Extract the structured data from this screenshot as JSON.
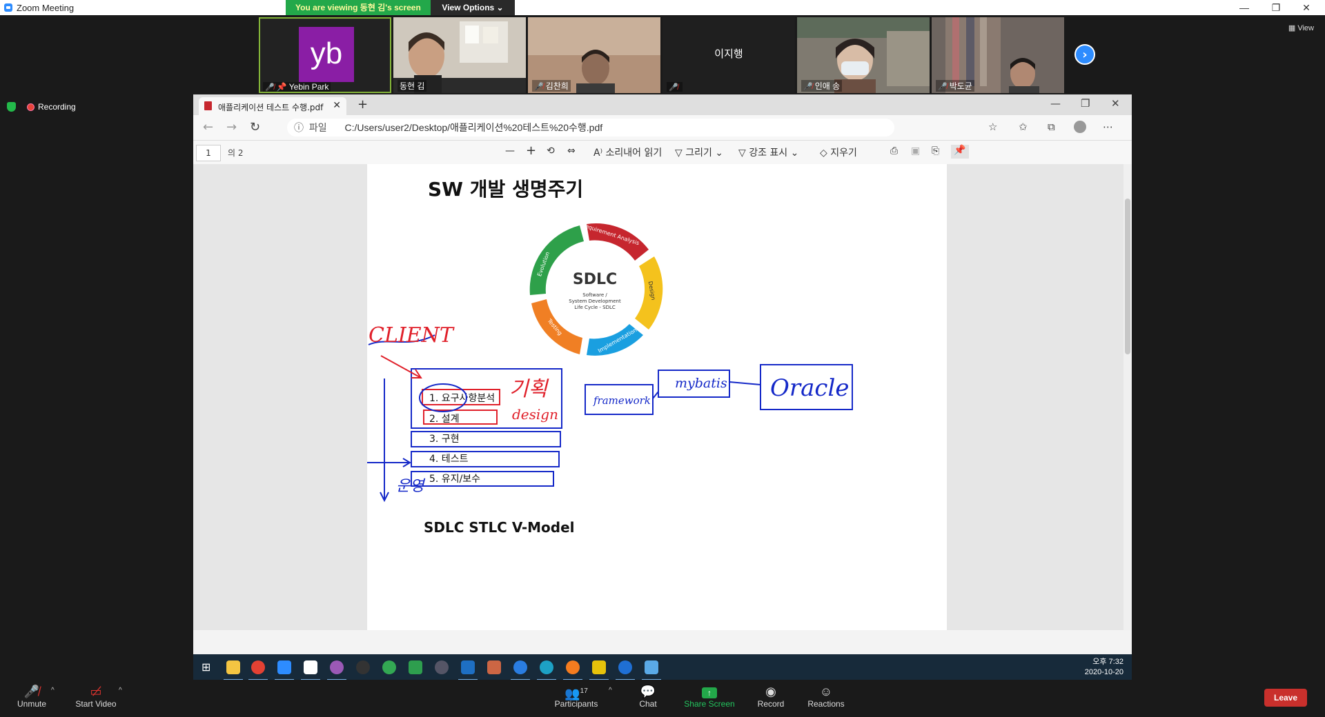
{
  "window": {
    "title": "Zoom Meeting"
  },
  "banner": {
    "message": "You are viewing 동현 김's screen",
    "view_options": "View Options ⌄"
  },
  "view_button": "View",
  "participants_strip": [
    {
      "name": "Yebin Park",
      "initials": "yb"
    },
    {
      "name": "동현 김"
    },
    {
      "name": "김찬희"
    },
    {
      "name": "",
      "center_name": "이지행"
    },
    {
      "name": "인애 송"
    },
    {
      "name": "박도균"
    }
  ],
  "recording": {
    "label": "Recording"
  },
  "browser": {
    "tab_title": "애플리케이션 테스트 수행.pdf",
    "scheme_label": "파일",
    "url": "C:/Users/user2/Desktop/애플리케이션%20테스트%20수행.pdf",
    "page_current": "1",
    "page_count": "의 2",
    "toolbar": {
      "read_aloud": "소리내어 읽기",
      "draw": "그리기",
      "highlight": "강조 표시",
      "erase": "지우기"
    }
  },
  "slide": {
    "title": "SW 개발 생명주기",
    "cycle_center": "SDLC",
    "cycle_subtitle_1": "Software /",
    "cycle_subtitle_2": "System Development",
    "cycle_subtitle_3": "Life Cycle - SDLC",
    "cycle_segments": [
      "Requirement Analysis",
      "Design",
      "Implementation",
      "Testing",
      "Evolution"
    ],
    "steps": [
      "1. 요구사항분석",
      "2. 설계",
      "3. 구현",
      "4. 테스트",
      "5. 유지/보수"
    ],
    "bottom_title": "SDLC STLC V-Model",
    "handwriting": {
      "client": "CLIENT",
      "plan": "기획",
      "design": "design",
      "framework": "framework",
      "mybatis": "mybatis",
      "oracle": "Oracle",
      "ops": "운영"
    }
  },
  "taskbar": {
    "time": "오후 7:32",
    "date": "2020-10-20"
  },
  "toolbar": {
    "unmute": "Unmute",
    "start_video": "Start Video",
    "participants": "Participants",
    "participant_count": "17",
    "chat": "Chat",
    "share_screen": "Share Screen",
    "record": "Record",
    "reactions": "Reactions",
    "leave": "Leave"
  },
  "colors": {
    "zoom_blue": "#2d8cff",
    "share_green": "#23a84a",
    "leave_red": "#c9302c",
    "ink_blue": "#1428c8",
    "ink_red": "#e0202a"
  }
}
